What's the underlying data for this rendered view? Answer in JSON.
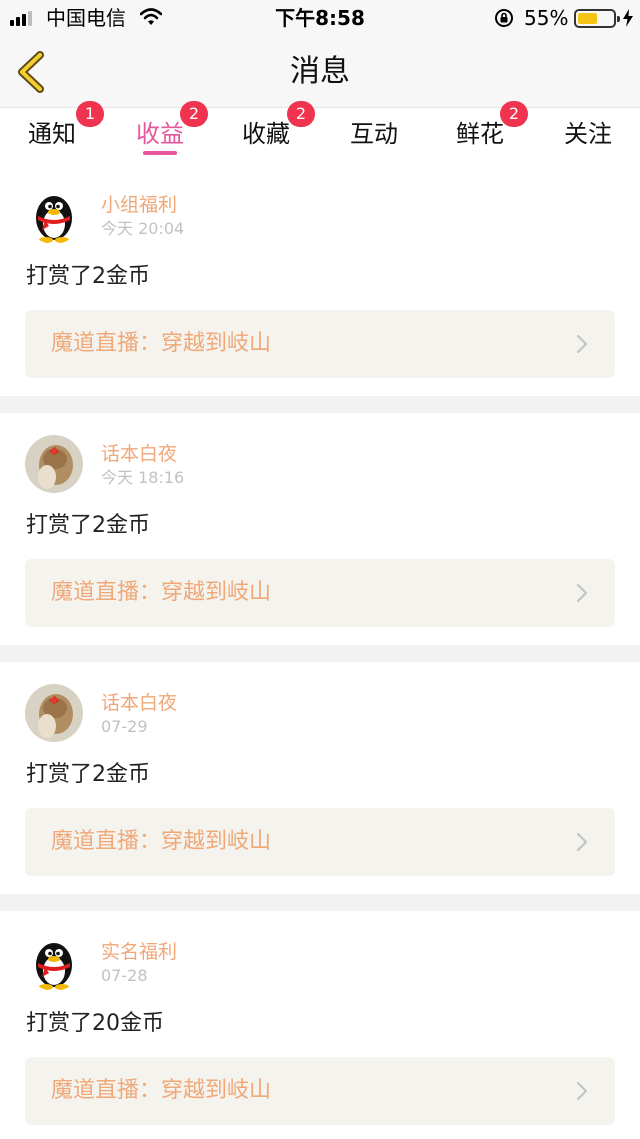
{
  "status_bar": {
    "carrier": "中国电信",
    "time": "下午8:58",
    "battery_percent": "55%",
    "battery_level": 0.55
  },
  "nav": {
    "title": "消息",
    "back_icon": "chevron-left-icon"
  },
  "tabs": [
    {
      "label": "通知",
      "badge": "1",
      "active": false
    },
    {
      "label": "收益",
      "badge": "2",
      "active": true
    },
    {
      "label": "收藏",
      "badge": "2",
      "active": false
    },
    {
      "label": "互动",
      "badge": "",
      "active": false
    },
    {
      "label": "鲜花",
      "badge": "2",
      "active": false
    },
    {
      "label": "关注",
      "badge": "",
      "active": false
    }
  ],
  "feed": [
    {
      "avatar": "penguin-avatar",
      "user": "小组福利",
      "time": "今天 20:04",
      "message": "打赏了2金币",
      "link": "魔道直播：穿越到岐山"
    },
    {
      "avatar": "photo-avatar",
      "user": "话本白夜",
      "time": "今天 18:16",
      "message": "打赏了2金币",
      "link": "魔道直播：穿越到岐山"
    },
    {
      "avatar": "photo-avatar",
      "user": "话本白夜",
      "time": "07-29",
      "message": "打赏了2金币",
      "link": "魔道直播：穿越到岐山"
    },
    {
      "avatar": "penguin-avatar",
      "user": "实名福利",
      "time": "07-28",
      "message": "打赏了20金币",
      "link": "魔道直播：穿越到岐山"
    }
  ],
  "colors": {
    "accent": "#e8579b",
    "badge": "#f0344f",
    "username": "#f0a878",
    "link_box_bg": "#f5f3ee",
    "separator": "#f2f2f2",
    "battery": "#f5c516"
  }
}
